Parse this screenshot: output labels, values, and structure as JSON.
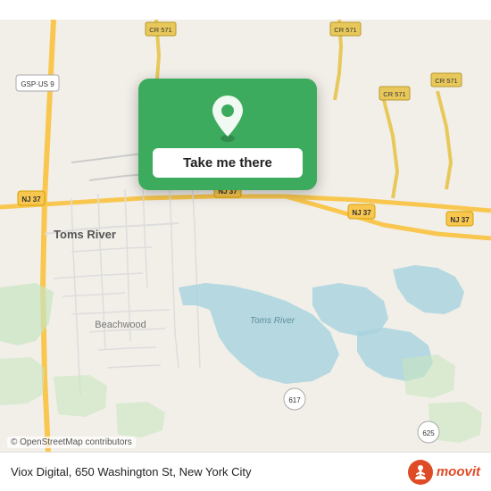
{
  "map": {
    "alt": "Map of Toms River, New Jersey area"
  },
  "card": {
    "button_label": "Take me there",
    "pin_icon": "location-pin-icon"
  },
  "bottom_bar": {
    "address": "Viox Digital, 650 Washington St, New York City",
    "osm_credit": "© OpenStreetMap contributors",
    "logo_text": "moovit"
  }
}
